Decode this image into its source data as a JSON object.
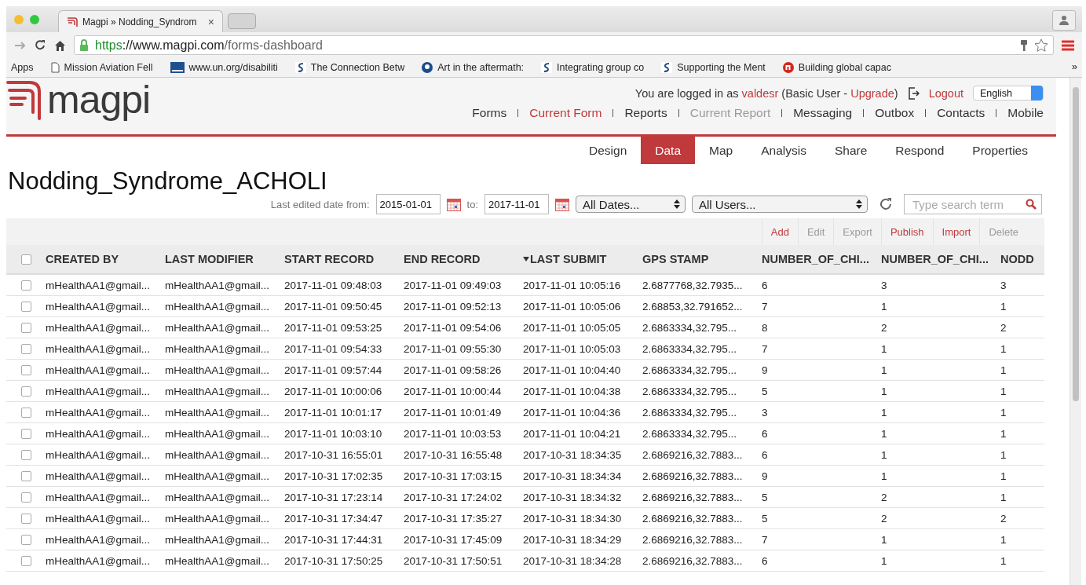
{
  "browser": {
    "tab": {
      "title": "Magpi » Nodding_Syndrom",
      "close": "×"
    },
    "address": {
      "scheme": "https",
      "sep": "://",
      "host": "www.magpi.com",
      "path": "/forms-dashboard"
    },
    "bookmarks": [
      {
        "kind": "apps",
        "label": "Apps"
      },
      {
        "kind": "page",
        "label": "Mission Aviation Fell"
      },
      {
        "kind": "un",
        "label": "www.un.org/disabiliti"
      },
      {
        "kind": "s",
        "label": "The Connection Betw"
      },
      {
        "kind": "g",
        "label": "Art in the aftermath:"
      },
      {
        "kind": "s",
        "label": "Integrating group co"
      },
      {
        "kind": "s",
        "label": "Supporting the Ment"
      },
      {
        "kind": "n",
        "label": "Building global capac"
      }
    ],
    "more": "»"
  },
  "header": {
    "logo": "magpi",
    "login": {
      "prefix": "You are logged in as",
      "user": "valdesr",
      "middle": "(Basic User -",
      "upgrade": "Upgrade",
      "suffix": ")"
    },
    "logout": "Logout",
    "language": "English",
    "nav": [
      {
        "label": "Forms",
        "selected": false,
        "disabled": false
      },
      {
        "label": "Current Form",
        "selected": true,
        "disabled": false
      },
      {
        "label": "Reports",
        "selected": false,
        "disabled": false
      },
      {
        "label": "Current Report",
        "selected": false,
        "disabled": true
      },
      {
        "label": "Messaging",
        "selected": false,
        "disabled": false
      },
      {
        "label": "Outbox",
        "selected": false,
        "disabled": false
      },
      {
        "label": "Contacts",
        "selected": false,
        "disabled": false
      },
      {
        "label": "Mobile",
        "selected": false,
        "disabled": false
      }
    ]
  },
  "tabs": [
    {
      "label": "Design",
      "selected": false
    },
    {
      "label": "Data",
      "selected": true
    },
    {
      "label": "Map",
      "selected": false
    },
    {
      "label": "Analysis",
      "selected": false
    },
    {
      "label": "Share",
      "selected": false
    },
    {
      "label": "Respond",
      "selected": false
    },
    {
      "label": "Properties",
      "selected": false
    }
  ],
  "title": "Nodding_Syndrome_ACHOLI",
  "filters": {
    "from_label": "Last edited date from:",
    "from": "2015-01-01",
    "to_label": "to:",
    "to": "2017-11-01",
    "dates": "All Dates...",
    "users": "All Users...",
    "search": {
      "placeholder": "Type search term"
    }
  },
  "actions": [
    {
      "label": "Add",
      "disabled": false
    },
    {
      "label": "Edit",
      "disabled": true
    },
    {
      "label": "Export",
      "disabled": true
    },
    {
      "label": "Publish",
      "disabled": false
    },
    {
      "label": "Import",
      "disabled": false
    },
    {
      "label": "Delete",
      "disabled": true
    }
  ],
  "table": {
    "select_all": {
      "checked": false
    },
    "columns": [
      {
        "label": "CREATED BY",
        "sorted": false
      },
      {
        "label": "LAST MODIFIER",
        "sorted": false
      },
      {
        "label": "START RECORD",
        "sorted": false
      },
      {
        "label": "END RECORD",
        "sorted": false
      },
      {
        "label": "LAST SUBMIT",
        "sorted": true
      },
      {
        "label": "GPS STAMP",
        "sorted": false
      },
      {
        "label": "NUMBER_OF_CHI...",
        "sorted": false
      },
      {
        "label": "NUMBER_OF_CHI...",
        "sorted": false
      },
      {
        "label": "NODD",
        "sorted": false
      }
    ],
    "rows": [
      {
        "checked": false,
        "cells": [
          "mHealthAA1@gmail...",
          "mHealthAA1@gmail...",
          "2017-11-01 09:48:03",
          "2017-11-01 09:49:03",
          "2017-11-01 10:05:16",
          "2.6877768,32.7935...",
          "6",
          "3",
          "3"
        ]
      },
      {
        "checked": false,
        "cells": [
          "mHealthAA1@gmail...",
          "mHealthAA1@gmail...",
          "2017-11-01 09:50:45",
          "2017-11-01 09:52:13",
          "2017-11-01 10:05:06",
          "2.68853,32.791652...",
          "7",
          "1",
          "1"
        ]
      },
      {
        "checked": false,
        "cells": [
          "mHealthAA1@gmail...",
          "mHealthAA1@gmail...",
          "2017-11-01 09:53:25",
          "2017-11-01 09:54:06",
          "2017-11-01 10:05:05",
          "2.6863334,32.795...",
          "8",
          "2",
          "2"
        ]
      },
      {
        "checked": false,
        "cells": [
          "mHealthAA1@gmail...",
          "mHealthAA1@gmail...",
          "2017-11-01 09:54:33",
          "2017-11-01 09:55:30",
          "2017-11-01 10:05:03",
          "2.6863334,32.795...",
          "7",
          "1",
          "1"
        ]
      },
      {
        "checked": false,
        "cells": [
          "mHealthAA1@gmail...",
          "mHealthAA1@gmail...",
          "2017-11-01 09:57:44",
          "2017-11-01 09:58:26",
          "2017-11-01 10:04:40",
          "2.6863334,32.795...",
          "9",
          "1",
          "1"
        ]
      },
      {
        "checked": false,
        "cells": [
          "mHealthAA1@gmail...",
          "mHealthAA1@gmail...",
          "2017-11-01 10:00:06",
          "2017-11-01 10:00:44",
          "2017-11-01 10:04:38",
          "2.6863334,32.795...",
          "5",
          "1",
          "1"
        ]
      },
      {
        "checked": false,
        "cells": [
          "mHealthAA1@gmail...",
          "mHealthAA1@gmail...",
          "2017-11-01 10:01:17",
          "2017-11-01 10:01:49",
          "2017-11-01 10:04:36",
          "2.6863334,32.795...",
          "3",
          "1",
          "1"
        ]
      },
      {
        "checked": false,
        "cells": [
          "mHealthAA1@gmail...",
          "mHealthAA1@gmail...",
          "2017-11-01 10:03:10",
          "2017-11-01 10:03:53",
          "2017-11-01 10:04:21",
          "2.6863334,32.795...",
          "6",
          "1",
          "1"
        ]
      },
      {
        "checked": false,
        "cells": [
          "mHealthAA1@gmail...",
          "mHealthAA1@gmail...",
          "2017-10-31 16:55:01",
          "2017-10-31 16:55:48",
          "2017-10-31 18:34:35",
          "2.6869216,32.7883...",
          "6",
          "1",
          "1"
        ]
      },
      {
        "checked": false,
        "cells": [
          "mHealthAA1@gmail...",
          "mHealthAA1@gmail...",
          "2017-10-31 17:02:35",
          "2017-10-31 17:03:15",
          "2017-10-31 18:34:34",
          "2.6869216,32.7883...",
          "9",
          "1",
          "1"
        ]
      },
      {
        "checked": false,
        "cells": [
          "mHealthAA1@gmail...",
          "mHealthAA1@gmail...",
          "2017-10-31 17:23:14",
          "2017-10-31 17:24:02",
          "2017-10-31 18:34:32",
          "2.6869216,32.7883...",
          "5",
          "2",
          "1"
        ]
      },
      {
        "checked": false,
        "cells": [
          "mHealthAA1@gmail...",
          "mHealthAA1@gmail...",
          "2017-10-31 17:34:47",
          "2017-10-31 17:35:27",
          "2017-10-31 18:34:30",
          "2.6869216,32.7883...",
          "5",
          "2",
          "2"
        ]
      },
      {
        "checked": false,
        "cells": [
          "mHealthAA1@gmail...",
          "mHealthAA1@gmail...",
          "2017-10-31 17:44:31",
          "2017-10-31 17:45:09",
          "2017-10-31 18:34:29",
          "2.6869216,32.7883...",
          "7",
          "1",
          "1"
        ]
      },
      {
        "checked": false,
        "cells": [
          "mHealthAA1@gmail...",
          "mHealthAA1@gmail...",
          "2017-10-31 17:50:25",
          "2017-10-31 17:50:51",
          "2017-10-31 18:34:28",
          "2.6869216,32.7883...",
          "6",
          "1",
          "1"
        ]
      }
    ]
  }
}
